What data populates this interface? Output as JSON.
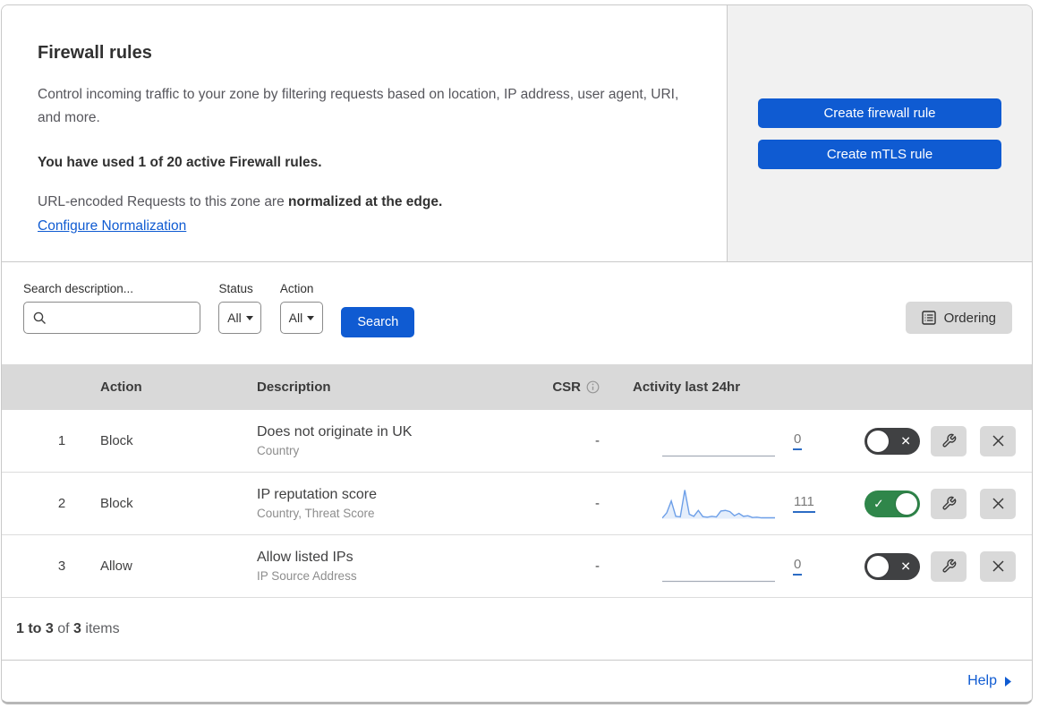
{
  "colors": {
    "primary_blue": "#0f5bd2",
    "toggle_on_green": "#2f864a",
    "toggle_off_gray": "#404143",
    "sparkline_line": "#6d9fe8",
    "sparkline_fill": "rgba(109,159,232,0.18)",
    "flatline_gray": "#a5adb8",
    "table_header_bg": "#d9d9d9"
  },
  "icons": {
    "check": "✓",
    "x": "✕"
  },
  "panel": {
    "title": "Firewall rules",
    "description": "Control incoming traffic to your zone by filtering requests based on location, IP address, user agent, URI, and more.",
    "usage_text": "You have used 1 of 20 active Firewall rules.",
    "normalization_prefix": "URL-encoded Requests to this zone are ",
    "normalization_bold": "normalized at the edge.",
    "normalization_link": "Configure Normalization",
    "create_firewall_rule": "Create firewall rule",
    "create_mtls_rule": "Create mTLS rule"
  },
  "filters": {
    "search_label": "Search description...",
    "status_label": "Status",
    "status_value": "All",
    "action_label": "Action",
    "action_value": "All",
    "search_button": "Search",
    "ordering_button": "Ordering"
  },
  "table": {
    "headers": {
      "action": "Action",
      "description": "Description",
      "csr": "CSR",
      "activity": "Activity last 24hr"
    },
    "rows": [
      {
        "number": "1",
        "action": "Block",
        "description": "Does not originate in UK",
        "fields": "Country",
        "csr": "-",
        "count": "0",
        "enabled": false,
        "sparkline": []
      },
      {
        "number": "2",
        "action": "Block",
        "description": "IP reputation score",
        "fields": "Country, Threat Score",
        "csr": "-",
        "count": "111",
        "enabled": true,
        "sparkline": [
          2,
          20,
          60,
          8,
          6,
          97,
          15,
          8,
          28,
          7,
          5,
          8,
          6,
          26,
          28,
          24,
          10,
          18,
          8,
          10,
          4,
          5,
          3,
          3,
          3,
          3
        ]
      },
      {
        "number": "3",
        "action": "Allow",
        "description": "Allow listed IPs",
        "fields": "IP Source Address",
        "csr": "-",
        "count": "0",
        "enabled": false,
        "sparkline": []
      }
    ]
  },
  "footer": {
    "range": "1 to 3",
    "of": "of",
    "total": "3",
    "items": "items"
  },
  "help": {
    "label": "Help"
  }
}
